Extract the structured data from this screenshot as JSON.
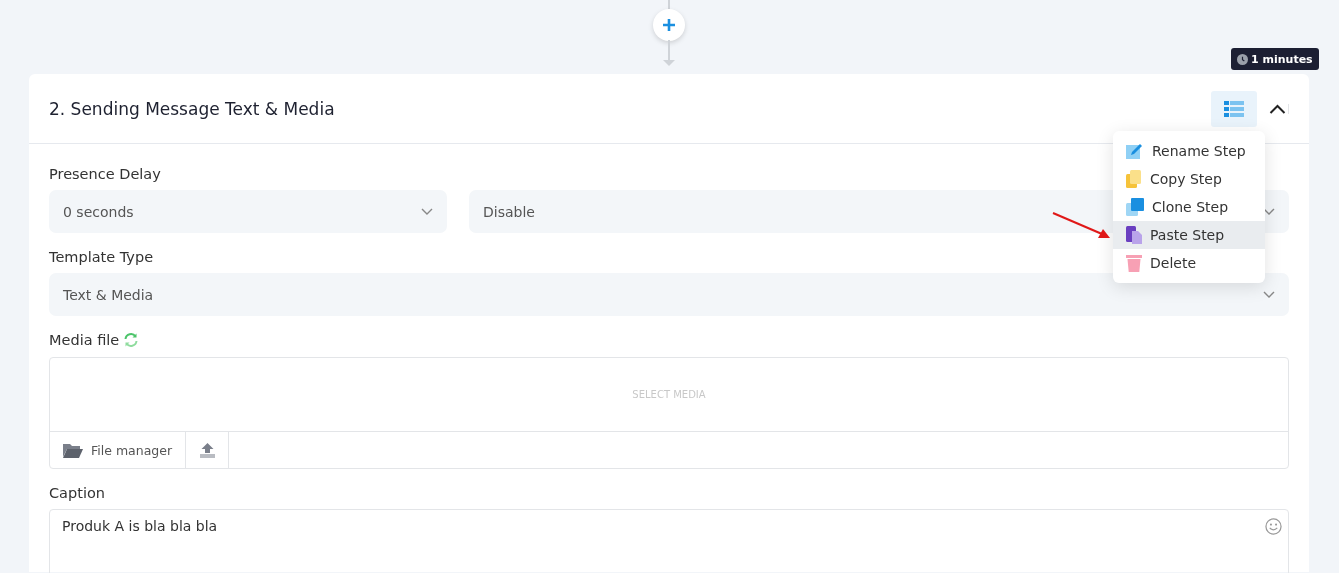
{
  "timer_badge": {
    "text": "1 minutes"
  },
  "step": {
    "title": "2. Sending Message Text & Media",
    "expanded": true
  },
  "step_menu": {
    "items": [
      {
        "label": "Rename Step",
        "kind": "rename",
        "selected": false
      },
      {
        "label": "Copy Step",
        "kind": "copy",
        "selected": false
      },
      {
        "label": "Clone Step",
        "kind": "clone",
        "selected": false
      },
      {
        "label": "Paste Step",
        "kind": "paste",
        "selected": true
      },
      {
        "label": "Delete",
        "kind": "delete",
        "selected": false
      }
    ]
  },
  "presence_delay": {
    "label": "Presence Delay",
    "selects": [
      "0 seconds",
      "Disable"
    ]
  },
  "template_type": {
    "label": "Template Type",
    "value": "Text & Media"
  },
  "media_file": {
    "label": "Media file",
    "placeholder": "SELECT MEDIA",
    "file_manager": "File manager"
  },
  "caption": {
    "label": "Caption",
    "value": "Produk A is bla bla bla"
  }
}
